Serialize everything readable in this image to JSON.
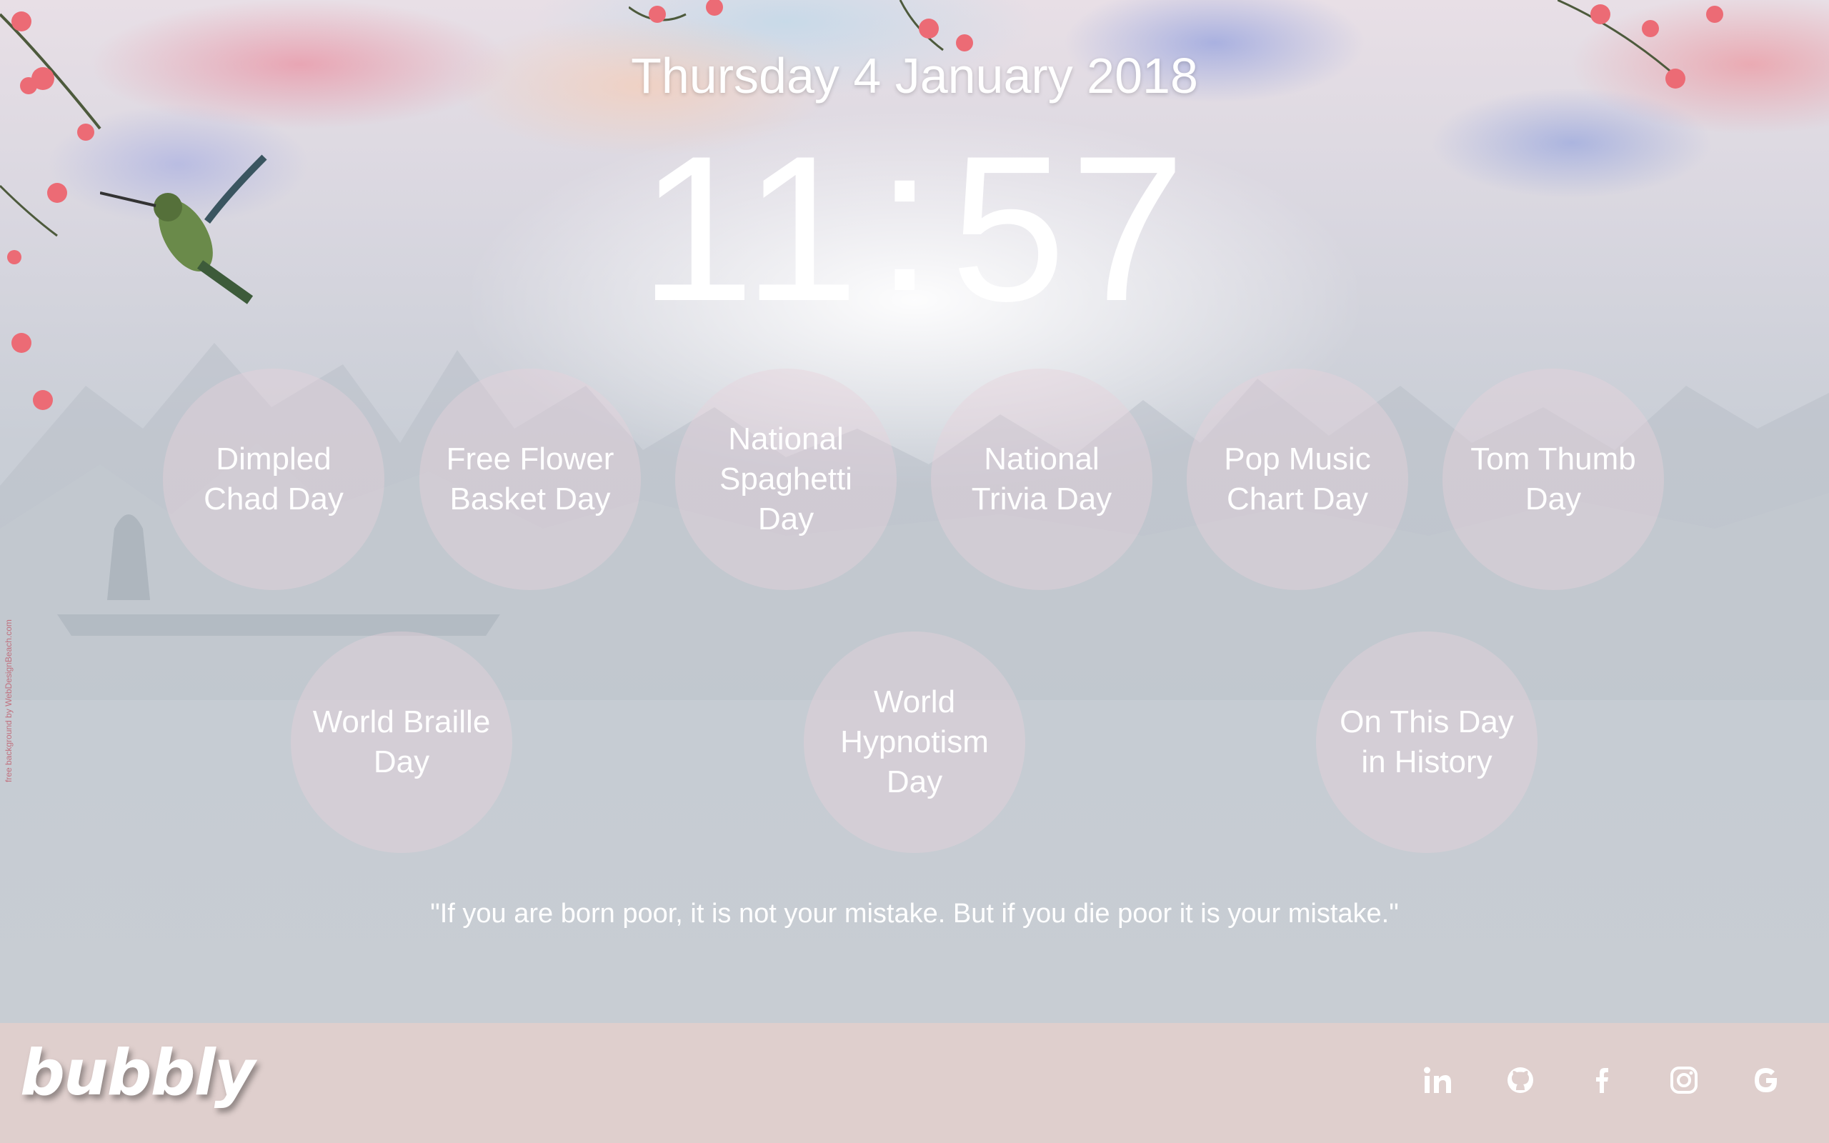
{
  "header": {
    "date": "Thursday 4 January 2018",
    "time_hours": "11",
    "time_separator": ":",
    "time_minutes": "57"
  },
  "events": {
    "row1": [
      {
        "line1": "Dimpled",
        "line2": "Chad Day",
        "line3": ""
      },
      {
        "line1": "Free Flower",
        "line2": "Basket Day",
        "line3": ""
      },
      {
        "line1": "National",
        "line2": "Spaghetti",
        "line3": "Day"
      },
      {
        "line1": "National",
        "line2": "Trivia Day",
        "line3": ""
      },
      {
        "line1": "Pop Music",
        "line2": "Chart Day",
        "line3": ""
      },
      {
        "line1": "Tom Thumb",
        "line2": "Day",
        "line3": ""
      }
    ],
    "row2": [
      {
        "line1": "World Braille",
        "line2": "Day",
        "line3": ""
      },
      {
        "line1": "World",
        "line2": "Hypnotism",
        "line3": "Day"
      },
      {
        "line1": "On This Day",
        "line2": "in History",
        "line3": ""
      }
    ]
  },
  "quote": "\"If you are born poor, it is not your mistake. But if you die poor it is your mistake.\"",
  "footer": {
    "logo": "bubbly",
    "social_icons": [
      "linkedin-icon",
      "github-icon",
      "facebook-icon",
      "instagram-icon",
      "google-icon"
    ]
  },
  "background_credit": "free background by WebDesignBeach.com",
  "colors": {
    "footer_bg": "#dfcfcd",
    "page_bg": "#c8cdd3",
    "bubble_fill": "rgba(232,210,220,0.42)",
    "text": "#ffffff"
  }
}
